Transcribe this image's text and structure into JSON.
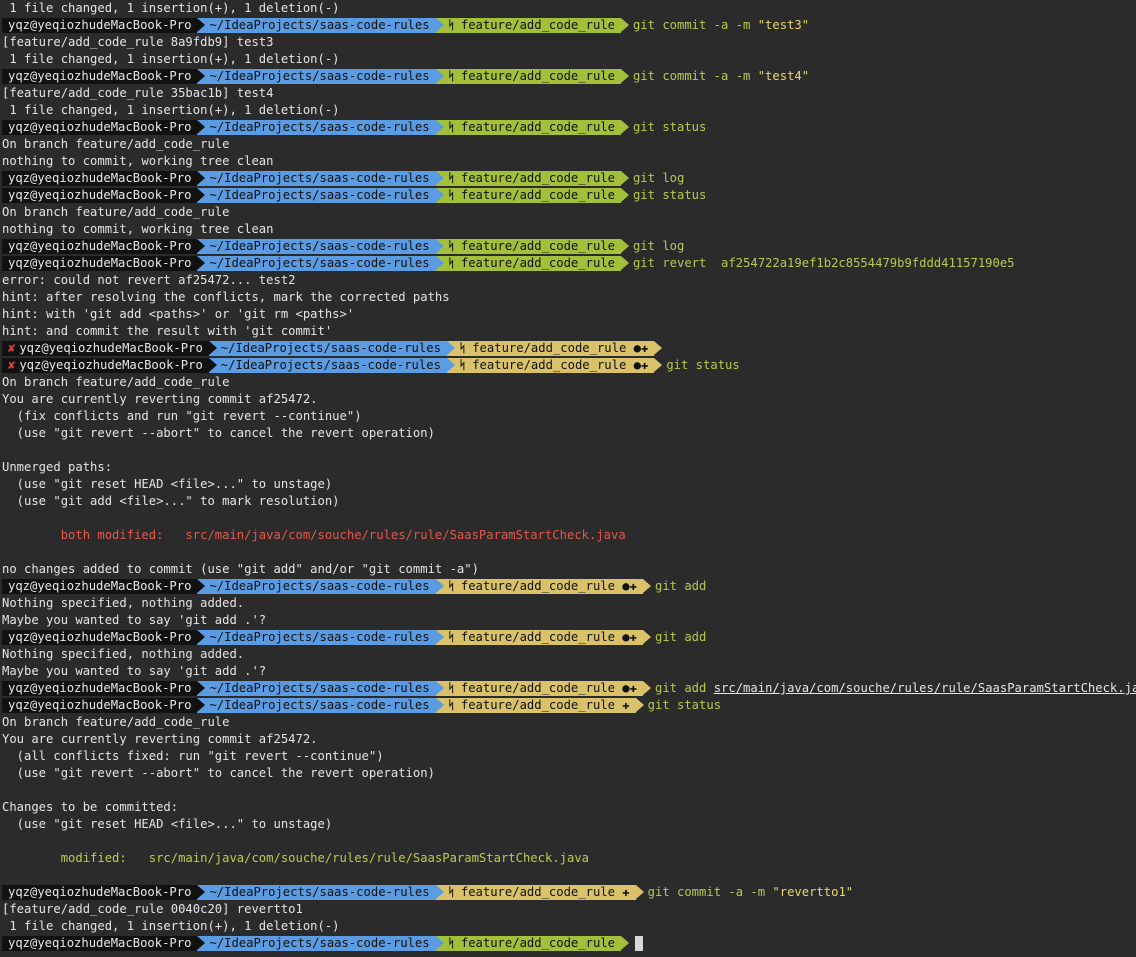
{
  "terminal": {
    "prompt": {
      "user": "yqz@yeqiozhudeMacBook-Pro",
      "dir": "~/IdeaProjects/saas-code-rules",
      "branch": "feature/add_code_rule",
      "branch_icon": "ᛋ",
      "fail_icon": "✘",
      "dirty_mark": "●✚",
      "staged_mark": "✚",
      "colors": {
        "user_bg": "#111111",
        "dir_bg": "#5a9be2",
        "branch_clean": "#a2c03a",
        "branch_dirty": "#d9c26a",
        "command": "#b8c94d"
      }
    },
    "lines": [
      {
        "type": "out",
        "text": " 1 file changed, 1 insertion(+), 1 deletion(-)"
      },
      {
        "type": "prompt",
        "state": "clean",
        "cmd": "git commit -a -m",
        "arg": "\"test3\""
      },
      {
        "type": "out",
        "text": "[feature/add_code_rule 8a9fdb9] test3"
      },
      {
        "type": "out",
        "text": " 1 file changed, 1 insertion(+), 1 deletion(-)"
      },
      {
        "type": "prompt",
        "state": "clean",
        "cmd": "git commit -a -m",
        "arg": "\"test4\""
      },
      {
        "type": "out",
        "text": "[feature/add_code_rule 35bac1b] test4"
      },
      {
        "type": "out",
        "text": " 1 file changed, 1 insertion(+), 1 deletion(-)"
      },
      {
        "type": "prompt",
        "state": "clean",
        "cmd": "git status"
      },
      {
        "type": "out",
        "text": "On branch feature/add_code_rule"
      },
      {
        "type": "out",
        "text": "nothing to commit, working tree clean"
      },
      {
        "type": "prompt",
        "state": "clean",
        "cmd": "git log"
      },
      {
        "type": "prompt",
        "state": "clean",
        "cmd": "git status"
      },
      {
        "type": "out",
        "text": "On branch feature/add_code_rule"
      },
      {
        "type": "out",
        "text": "nothing to commit, working tree clean"
      },
      {
        "type": "prompt",
        "state": "clean",
        "cmd": "git log"
      },
      {
        "type": "prompt",
        "state": "clean",
        "cmd": "git revert  af254722a19ef1b2c8554479b9fddd41157190e5"
      },
      {
        "type": "out",
        "text": "error: could not revert af25472... test2"
      },
      {
        "type": "out",
        "text": "hint: after resolving the conflicts, mark the corrected paths"
      },
      {
        "type": "out",
        "text": "hint: with 'git add <paths>' or 'git rm <paths>'"
      },
      {
        "type": "out",
        "text": "hint: and commit the result with 'git commit'"
      },
      {
        "type": "prompt",
        "state": "dirty",
        "fail": true,
        "cmd": ""
      },
      {
        "type": "prompt",
        "state": "dirty",
        "fail": true,
        "cmd": "git status"
      },
      {
        "type": "out",
        "text": "On branch feature/add_code_rule"
      },
      {
        "type": "out",
        "text": "You are currently reverting commit af25472."
      },
      {
        "type": "out",
        "text": "  (fix conflicts and run \"git revert --continue\")"
      },
      {
        "type": "out",
        "text": "  (use \"git revert --abort\" to cancel the revert operation)"
      },
      {
        "type": "out",
        "text": ""
      },
      {
        "type": "out",
        "text": "Unmerged paths:"
      },
      {
        "type": "out",
        "text": "  (use \"git reset HEAD <file>...\" to unstage)"
      },
      {
        "type": "out",
        "text": "  (use \"git add <file>...\" to mark resolution)"
      },
      {
        "type": "out",
        "text": ""
      },
      {
        "type": "out",
        "color": "red",
        "text": "        both modified:   src/main/java/com/souche/rules/rule/SaasParamStartCheck.java"
      },
      {
        "type": "out",
        "text": ""
      },
      {
        "type": "out",
        "text": "no changes added to commit (use \"git add\" and/or \"git commit -a\")"
      },
      {
        "type": "prompt",
        "state": "dirty",
        "cmd": "git add"
      },
      {
        "type": "out",
        "text": "Nothing specified, nothing added."
      },
      {
        "type": "out",
        "text": "Maybe you wanted to say 'git add .'?"
      },
      {
        "type": "prompt",
        "state": "dirty",
        "cmd": "git add"
      },
      {
        "type": "out",
        "text": "Nothing specified, nothing added."
      },
      {
        "type": "out",
        "text": "Maybe you wanted to say 'git add .'?"
      },
      {
        "type": "prompt",
        "state": "dirty",
        "cmd": "git add",
        "path": "src/main/java/com/souche/rules/rule/SaasParamStartCheck.java"
      },
      {
        "type": "prompt",
        "state": "staged",
        "cmd": "git status"
      },
      {
        "type": "out",
        "text": "On branch feature/add_code_rule"
      },
      {
        "type": "out",
        "text": "You are currently reverting commit af25472."
      },
      {
        "type": "out",
        "text": "  (all conflicts fixed: run \"git revert --continue\")"
      },
      {
        "type": "out",
        "text": "  (use \"git revert --abort\" to cancel the revert operation)"
      },
      {
        "type": "out",
        "text": ""
      },
      {
        "type": "out",
        "text": "Changes to be committed:"
      },
      {
        "type": "out",
        "text": "  (use \"git reset HEAD <file>...\" to unstage)"
      },
      {
        "type": "out",
        "text": ""
      },
      {
        "type": "out",
        "color": "yellow",
        "text": "        modified:   src/main/java/com/souche/rules/rule/SaasParamStartCheck.java"
      },
      {
        "type": "out",
        "text": ""
      },
      {
        "type": "prompt",
        "state": "staged",
        "cmd": "git commit -a -m",
        "arg": "\"revertto1\""
      },
      {
        "type": "out",
        "text": "[feature/add_code_rule 0040c20] revertto1"
      },
      {
        "type": "out",
        "text": " 1 file changed, 1 insertion(+), 1 deletion(-)"
      },
      {
        "type": "prompt",
        "state": "clean",
        "cmd": "",
        "cursor": true
      }
    ]
  }
}
